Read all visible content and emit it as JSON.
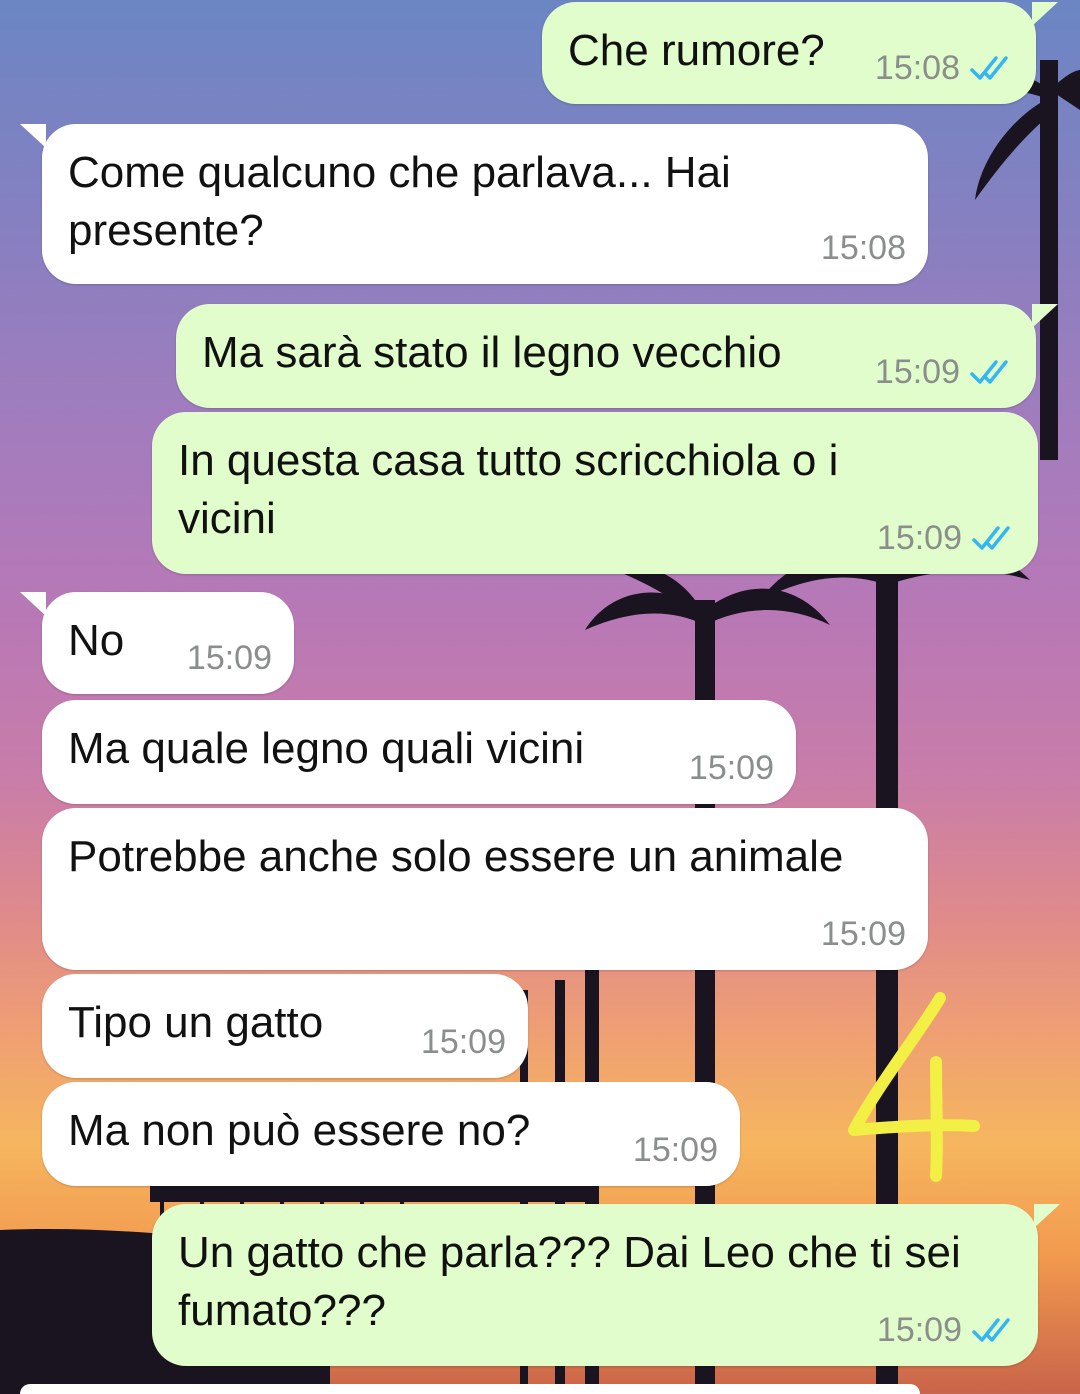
{
  "messages": [
    {
      "dir": "out",
      "text": "Che rumore?",
      "time": "15:08",
      "status": "read"
    },
    {
      "dir": "in",
      "text": "Come qualcuno che parlava... Hai\npresente?",
      "time": "15:08"
    },
    {
      "dir": "out",
      "text": "Ma sarà stato il legno vecchio",
      "time": "15:09",
      "status": "read"
    },
    {
      "dir": "out",
      "text": "In questa casa tutto scricchiola o i\nvicini",
      "time": "15:09",
      "status": "read"
    },
    {
      "dir": "in",
      "text": "No",
      "time": "15:09"
    },
    {
      "dir": "in",
      "text": "Ma quale legno quali vicini",
      "time": "15:09"
    },
    {
      "dir": "in",
      "text": "Potrebbe anche solo essere un animale",
      "time": "15:09"
    },
    {
      "dir": "in",
      "text": "Tipo un gatto",
      "time": "15:09"
    },
    {
      "dir": "in",
      "text": "Ma non può essere no?",
      "time": "15:09"
    },
    {
      "dir": "out",
      "text": "Un gatto che parla??? Dai Leo che ti sei\nfumato???",
      "time": "15:09",
      "status": "read"
    }
  ],
  "annotation": {
    "text": "4",
    "color": "#f2f044"
  },
  "colors": {
    "outgoing_bubble": "#e2fdcc",
    "incoming_bubble": "#ffffff",
    "read_ticks": "#34b7f1",
    "timestamp": "#8a8f8c"
  },
  "icons": {
    "read_receipt": "double-check-icon"
  }
}
